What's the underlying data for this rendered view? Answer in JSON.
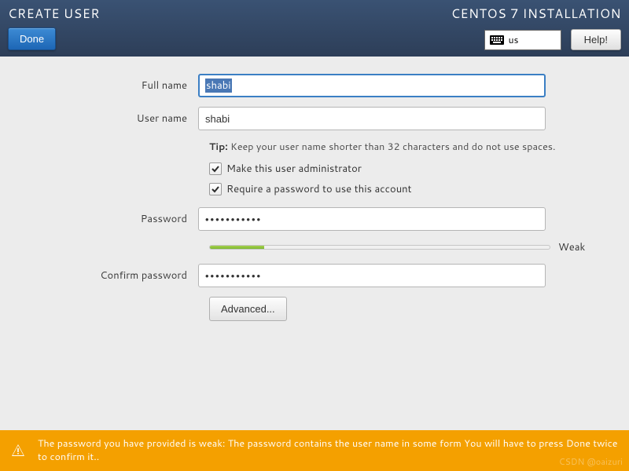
{
  "header": {
    "title_left": "CREATE USER",
    "title_right": "CENTOS 7 INSTALLATION",
    "done_label": "Done",
    "keyboard_layout": "us",
    "help_label": "Help!"
  },
  "form": {
    "fullname_label": "Full name",
    "fullname_value": "shabi",
    "username_label": "User name",
    "username_value": "shabi",
    "tip_bold": "Tip:",
    "tip_text": " Keep your user name shorter than 32 characters and do not use spaces.",
    "admin_checkbox_label": "Make this user administrator",
    "require_pw_checkbox_label": "Require a password to use this account",
    "password_label": "Password",
    "password_value": "•••••••••••",
    "strength_label": "Weak",
    "confirm_label": "Confirm password",
    "confirm_value": "•••••••••••",
    "advanced_label": "Advanced..."
  },
  "warning": {
    "text": "The password you have provided is weak: The password contains the user name in some form You will have to press Done twice to confirm it.."
  },
  "watermark": "CSDN @oaizuri"
}
